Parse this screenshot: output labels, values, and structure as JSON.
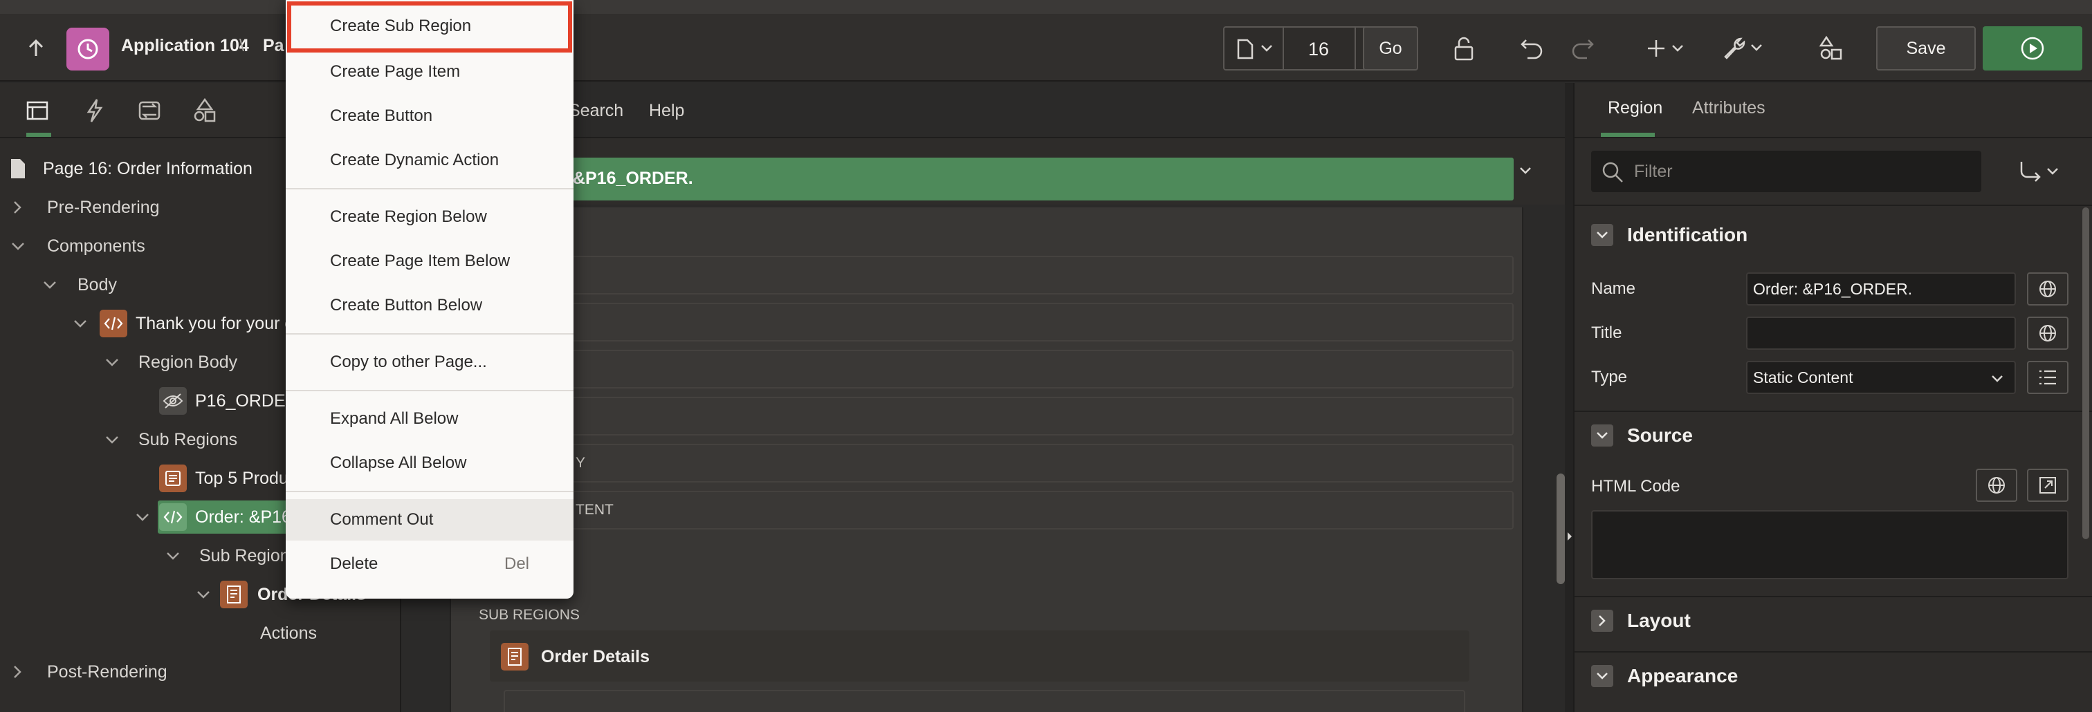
{
  "header": {
    "app_title": "Application 104",
    "breadcrumb_sep": "\\",
    "page_prefix": "Pa",
    "page_number": "16",
    "go_label": "Go",
    "save_label": "Save"
  },
  "left_panel": {
    "page_title": "Page 16: Order Information",
    "tree": {
      "pre_rendering": "Pre-Rendering",
      "components": "Components",
      "body": "Body",
      "thank_you_region": "Thank you for your o",
      "region_body": "Region Body",
      "p16_order": "P16_ORDER",
      "sub_regions": "Sub Regions",
      "top5": "Top 5 Produ",
      "order_region": "Order: &P16",
      "sub_regions_2": "Sub Regions",
      "order_details": "Order Details",
      "actions": "Actions",
      "post_rendering": "Post-Rendering"
    }
  },
  "center_panel": {
    "tabs": {
      "search": "Search",
      "help": "Help"
    },
    "region_title": "&P16_ORDER.",
    "slot_y": "Y",
    "slot_tent": "TENT",
    "sub_regions_label": "SUB REGIONS",
    "order_details_label": "Order Details"
  },
  "right_panel": {
    "tabs": {
      "region": "Region",
      "attributes": "Attributes"
    },
    "filter_placeholder": "Filter",
    "sections": {
      "identification": "Identification",
      "source": "Source",
      "layout": "Layout",
      "appearance": "Appearance"
    },
    "props": {
      "name_label": "Name",
      "name_value": "Order: &P16_ORDER.",
      "title_label": "Title",
      "title_value": "",
      "type_label": "Type",
      "type_value": "Static Content",
      "html_code_label": "HTML Code"
    }
  },
  "context_menu": {
    "items": [
      "Create Sub Region",
      "Create Page Item",
      "Create Button",
      "Create Dynamic Action",
      "Create Region Below",
      "Create Page Item Below",
      "Create Button Below",
      "Copy to other Page...",
      "Expand All Below",
      "Collapse All Below",
      "Comment Out",
      "Delete"
    ],
    "delete_shortcut": "Del"
  },
  "colors": {
    "accent_green": "#4e8a5a",
    "run_button": "#3f7d4b",
    "app_icon": "#c25fa8",
    "highlight_border": "#e5412a",
    "region_icon_orange": "#a35a35"
  }
}
